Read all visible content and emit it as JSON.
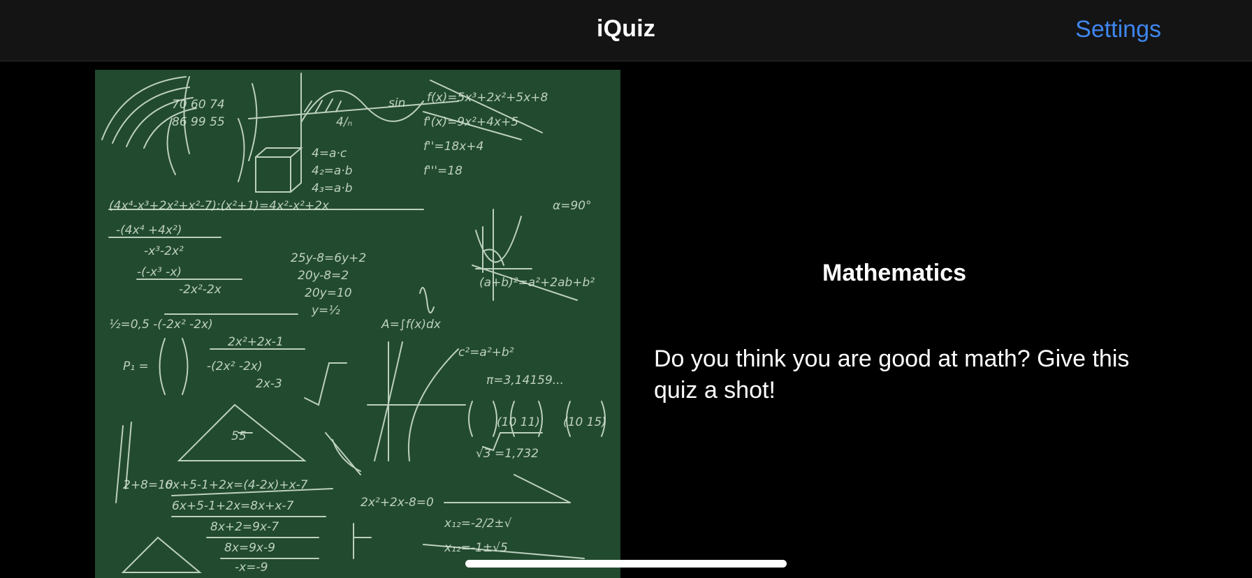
{
  "navbar": {
    "title": "iQuiz",
    "settings_label": "Settings"
  },
  "quiz": {
    "image_icon": "math-chalkboard-image",
    "title": "Mathematics",
    "description": "Do you think you are good at math? Give this quiz a shot!"
  },
  "colors": {
    "background": "#000000",
    "navbar": "#141414",
    "accent": "#3f86ef",
    "chalkboard": "#224a2f",
    "chalk": "#d8e8d8"
  }
}
